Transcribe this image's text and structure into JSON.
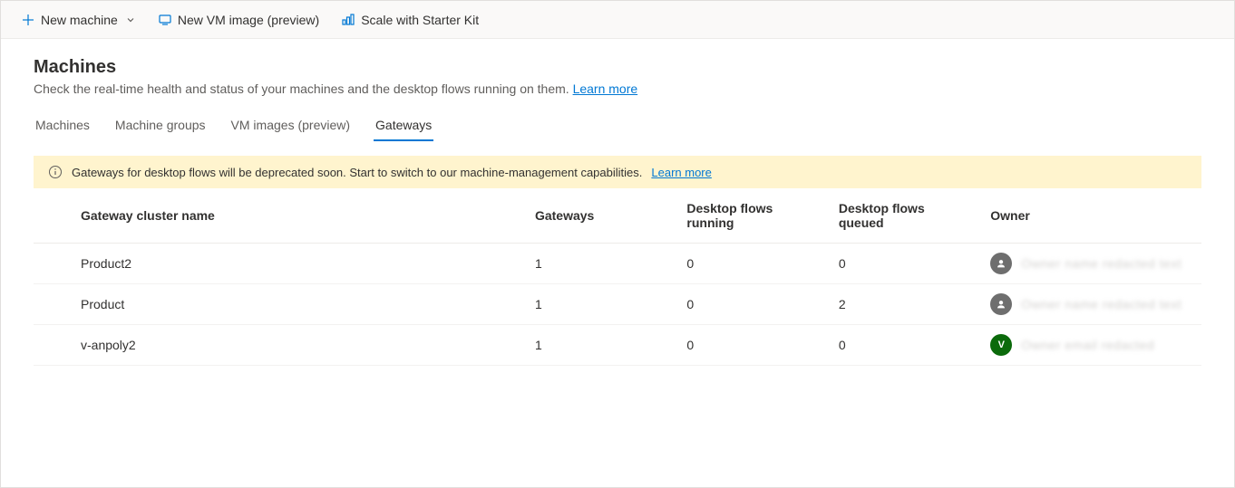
{
  "toolbar": {
    "newMachine": "New machine",
    "newVmImage": "New VM image (preview)",
    "scaleStarter": "Scale with Starter Kit"
  },
  "header": {
    "title": "Machines",
    "subtitle": "Check the real-time health and status of your machines and the desktop flows running on them. ",
    "learnMore": "Learn more"
  },
  "tabs": {
    "machines": "Machines",
    "groups": "Machine groups",
    "vmImages": "VM images (preview)",
    "gateways": "Gateways"
  },
  "banner": {
    "text": "Gateways for desktop flows will be deprecated soon. Start to switch to our machine-management capabilities.",
    "learnMore": "Learn more"
  },
  "table": {
    "headers": {
      "name": "Gateway cluster name",
      "gateways": "Gateways",
      "running": "Desktop flows running",
      "queued": "Desktop flows queued",
      "owner": "Owner"
    },
    "rows": [
      {
        "name": "Product2",
        "gateways": "1",
        "running": "0",
        "queued": "0",
        "ownerAvatar": "person",
        "ownerName": "Owner name redacted text"
      },
      {
        "name": "Product",
        "gateways": "1",
        "running": "0",
        "queued": "2",
        "ownerAvatar": "person",
        "ownerName": "Owner name redacted text"
      },
      {
        "name": "v-anpoly2",
        "gateways": "1",
        "running": "0",
        "queued": "0",
        "ownerAvatar": "V",
        "ownerName": "Owner email redacted"
      }
    ]
  }
}
